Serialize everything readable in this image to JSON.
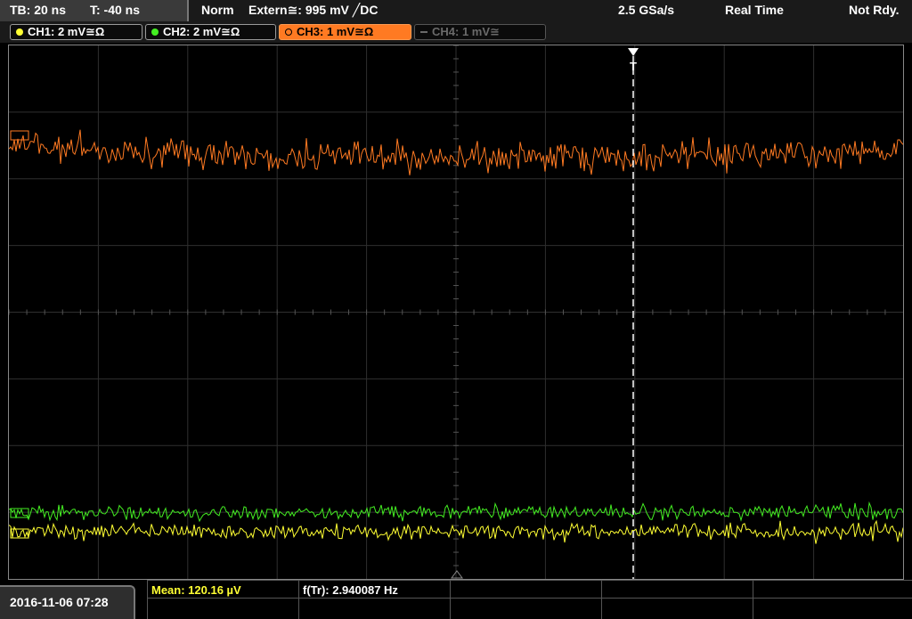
{
  "status_bar": {
    "timebase": "TB: 20 ns",
    "trigger_time": "T: -40 ns",
    "mode": "Norm",
    "trigger_source": "Extern≅: 995 mV ╱DC",
    "sample_rate": "2.5 GSa/s",
    "acq_mode": "Real Time",
    "state": "Not Rdy."
  },
  "channels": [
    {
      "label": "CH1: 2 mV≅Ω",
      "color": "#ffff33"
    },
    {
      "label": "CH2: 2 mV≅Ω",
      "color": "#44ee22"
    },
    {
      "label": "CH3: 1 mV≅Ω",
      "color": "#ff7a22"
    },
    {
      "label": "CH4: 1 mV≅",
      "color": "#6a6a6a"
    }
  ],
  "trigger_marker": "T",
  "bottom": {
    "datetime": "2016-11-06 07:28",
    "mean": "Mean: 120.16 µV",
    "freq": "f(Tr): 2.940087 Hz"
  },
  "colors": {
    "ch1": "#ffff33",
    "ch2": "#44ee22",
    "ch3": "#ff7a22",
    "grid": "#3a3a3a",
    "mean_text": "#ffff33"
  }
}
